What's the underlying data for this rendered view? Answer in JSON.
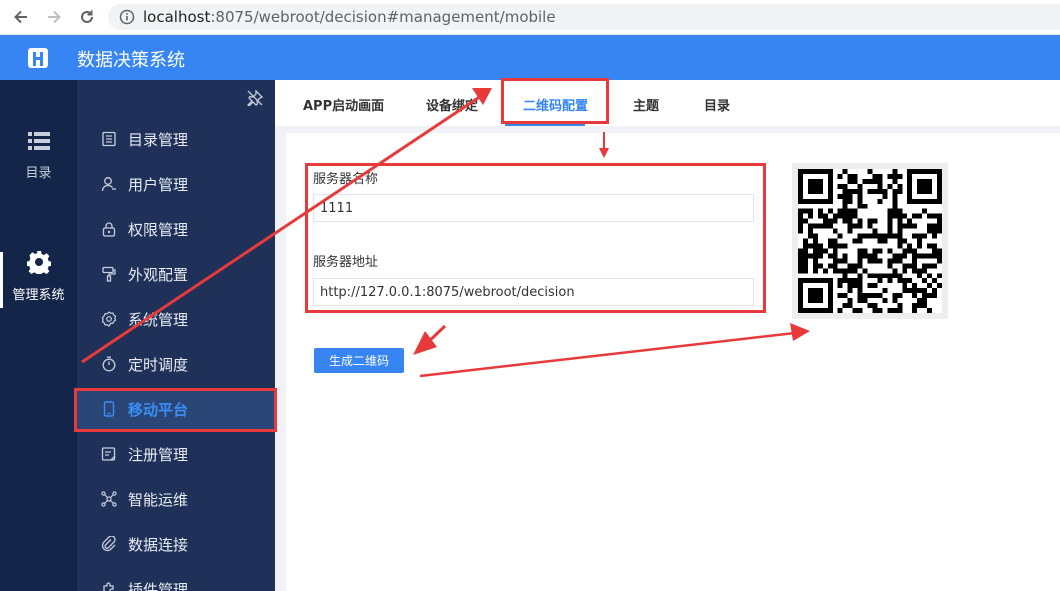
{
  "browser": {
    "url_host": "localhost",
    "url_rest": ":8075/webroot/decision#management/mobile"
  },
  "app": {
    "title": "数据决策系统"
  },
  "rail": [
    {
      "label": "目录",
      "icon": "list-icon"
    },
    {
      "label": "管理系统",
      "icon": "gear-icon"
    }
  ],
  "sidebar": {
    "items": [
      {
        "label": "目录管理",
        "icon": "directory-icon"
      },
      {
        "label": "用户管理",
        "icon": "user-icon"
      },
      {
        "label": "权限管理",
        "icon": "lock-icon"
      },
      {
        "label": "外观配置",
        "icon": "brush-icon"
      },
      {
        "label": "系统管理",
        "icon": "settings-icon"
      },
      {
        "label": "定时调度",
        "icon": "timer-icon"
      },
      {
        "label": "移动平台",
        "icon": "mobile-icon"
      },
      {
        "label": "注册管理",
        "icon": "register-icon"
      },
      {
        "label": "智能运维",
        "icon": "network-icon"
      },
      {
        "label": "数据连接",
        "icon": "link-icon"
      },
      {
        "label": "插件管理",
        "icon": "plugin-icon"
      }
    ]
  },
  "tabs": [
    {
      "label": "APP启动画面"
    },
    {
      "label": "设备绑定"
    },
    {
      "label": "二维码配置"
    },
    {
      "label": "主题"
    },
    {
      "label": "目录"
    }
  ],
  "form": {
    "server_name_label": "服务器名称",
    "server_name_value": "1111",
    "server_address_label": "服务器地址",
    "server_address_value": "http://127.0.0.1:8075/webroot/decision",
    "generate_button": "生成二维码"
  },
  "colors": {
    "header_blue": "#3685f2",
    "rail": "#14254a",
    "sidebar": "#1f3159",
    "annotation_red": "#e83a3a"
  }
}
